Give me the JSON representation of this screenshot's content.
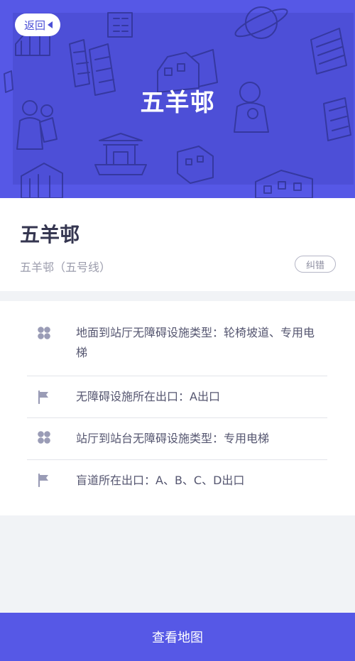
{
  "header": {
    "back_label": "返回",
    "title": "五羊邨",
    "background_color": "#5658e6"
  },
  "station": {
    "name": "五羊邨",
    "subtitle": "五羊邨（五号线）",
    "correct_label": "纠错"
  },
  "facilities": [
    {
      "icon": "clover-icon",
      "text": "地面到站厅无障碍设施类型：轮椅坡道、专用电梯"
    },
    {
      "icon": "flag-icon",
      "text": "无障碍设施所在出口：A出口"
    },
    {
      "icon": "clover-icon",
      "text": "站厅到站台无障碍设施类型：专用电梯"
    },
    {
      "icon": "flag-icon",
      "text": "盲道所在出口：A、B、C、D出口"
    }
  ],
  "footer": {
    "map_button_label": "查看地图"
  }
}
